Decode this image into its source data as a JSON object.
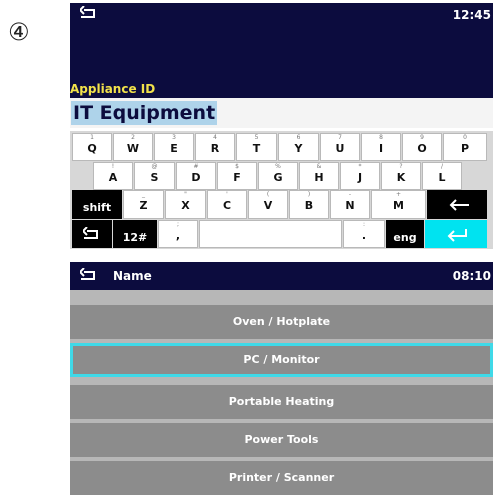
{
  "step_marker": "④",
  "keyboard_screen": {
    "time": "12:45",
    "field_label": "Appliance ID",
    "field_value": "IT Equipment",
    "keys": {
      "row1": [
        {
          "sub": "1",
          "main": "Q"
        },
        {
          "sub": "2",
          "main": "W"
        },
        {
          "sub": "3",
          "main": "E"
        },
        {
          "sub": "4",
          "main": "R"
        },
        {
          "sub": "5",
          "main": "T"
        },
        {
          "sub": "6",
          "main": "Y"
        },
        {
          "sub": "7",
          "main": "U"
        },
        {
          "sub": "8",
          "main": "I"
        },
        {
          "sub": "9",
          "main": "O"
        },
        {
          "sub": "0",
          "main": "P"
        }
      ],
      "row2": [
        {
          "sub": "!",
          "main": "A"
        },
        {
          "sub": "@",
          "main": "S"
        },
        {
          "sub": "#",
          "main": "D"
        },
        {
          "sub": "$",
          "main": "F"
        },
        {
          "sub": "%",
          "main": "G"
        },
        {
          "sub": "&",
          "main": "H"
        },
        {
          "sub": "*",
          "main": "J"
        },
        {
          "sub": "?",
          "main": "K"
        },
        {
          "sub": "/",
          "main": "L"
        }
      ],
      "row3": [
        {
          "sub": "_",
          "main": "Z"
        },
        {
          "sub": "\"",
          "main": "X"
        },
        {
          "sub": "'",
          "main": "C"
        },
        {
          "sub": "(",
          "main": "V"
        },
        {
          "sub": ")",
          "main": "B"
        },
        {
          "sub": "-",
          "main": "N"
        },
        {
          "sub": "+",
          "main": "M"
        }
      ],
      "shift_label": "shift",
      "num_label": "12#",
      "comma_sub": ";",
      "comma_main": ",",
      "period_sub": ":",
      "period_main": ".",
      "lang_label": "eng"
    }
  },
  "list_screen": {
    "title": "Name",
    "time": "08:10",
    "items": [
      {
        "label": "Oven / Hotplate"
      },
      {
        "label": "PC / Monitor",
        "selected": true
      },
      {
        "label": "Portable Heating"
      },
      {
        "label": "Power Tools"
      },
      {
        "label": "Printer / Scanner"
      }
    ]
  },
  "colors": {
    "header_bg": "#0c0c3e",
    "field_label": "#f2e24a",
    "selection": "#aed3ea",
    "accent_cyan": "#00e3f0",
    "list_item": "#8c8c8c",
    "list_bg": "#b7b7b7"
  }
}
